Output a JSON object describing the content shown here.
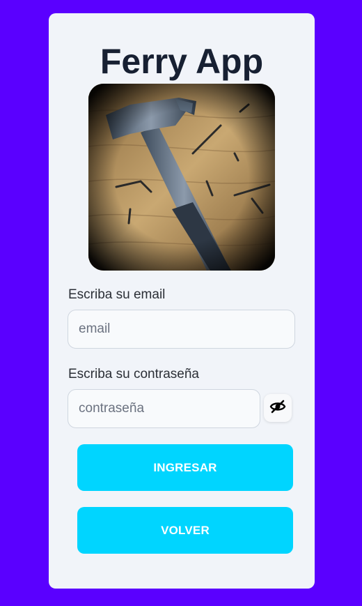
{
  "app": {
    "title": "Ferry App"
  },
  "photo": {
    "icon": "hammer-on-wood-image"
  },
  "email": {
    "label": "Escriba su email",
    "placeholder": "email",
    "value": ""
  },
  "password": {
    "label": "Escriba su contraseña",
    "placeholder": "contraseña",
    "value": "",
    "toggle_icon": "eye-slash-icon"
  },
  "buttons": {
    "login": "INGRESAR",
    "back": "VOLVER"
  },
  "colors": {
    "background": "#5a00ff",
    "card": "#f1f4f9",
    "button": "#00d5ff",
    "title": "#172032"
  }
}
